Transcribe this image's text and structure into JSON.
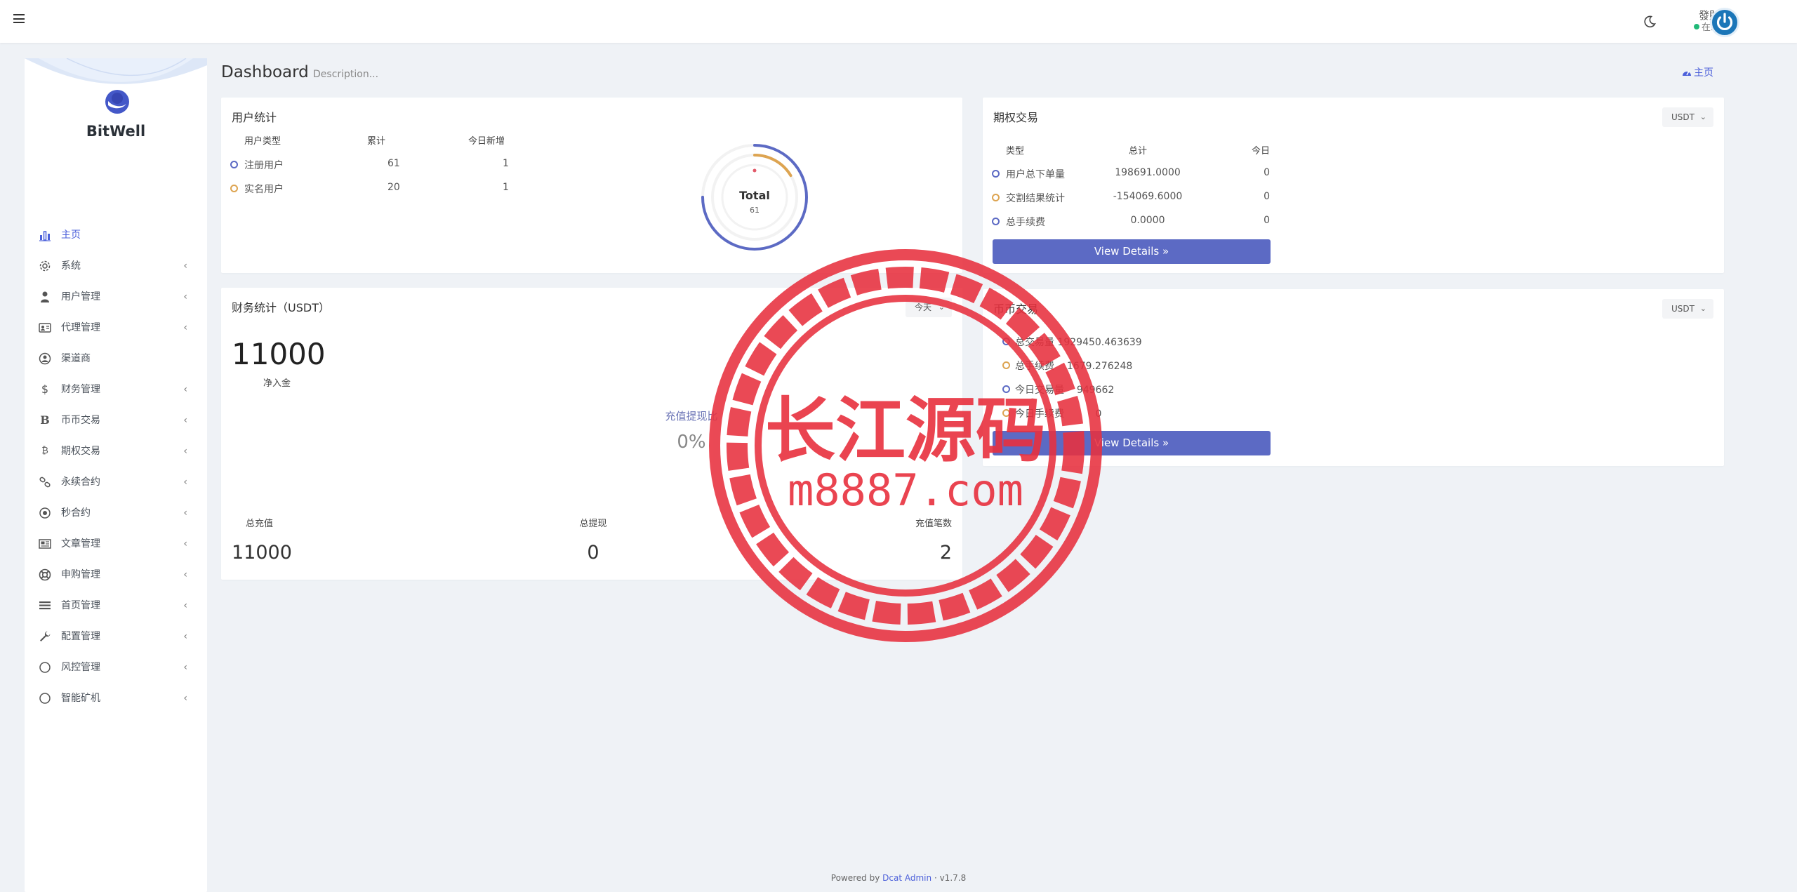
{
  "navbar": {
    "user_name": "發財",
    "user_status": "在线"
  },
  "sidebar": {
    "brand": "BitWell",
    "items": [
      {
        "label": "主页",
        "icon": "bar-chart-icon",
        "active": true,
        "chevron": false
      },
      {
        "label": "系统",
        "icon": "gear-icon",
        "chevron": true
      },
      {
        "label": "用户管理",
        "icon": "user-icon",
        "chevron": true
      },
      {
        "label": "代理管理",
        "icon": "id-card-icon",
        "chevron": true
      },
      {
        "label": "渠道商",
        "icon": "user-circle-icon",
        "chevron": false
      },
      {
        "label": "财务管理",
        "icon": "dollar-icon",
        "chevron": true
      },
      {
        "label": "币币交易",
        "icon": "bitcoin-b-icon",
        "chevron": true
      },
      {
        "label": "期权交易",
        "icon": "bitcoin-icon",
        "chevron": true
      },
      {
        "label": "永续合约",
        "icon": "link-icon",
        "chevron": true
      },
      {
        "label": "秒合约",
        "icon": "record-icon",
        "chevron": true
      },
      {
        "label": "文章管理",
        "icon": "newspaper-icon",
        "chevron": true
      },
      {
        "label": "申购管理",
        "icon": "lifebuoy-icon",
        "chevron": true
      },
      {
        "label": "首页管理",
        "icon": "list-icon",
        "chevron": true
      },
      {
        "label": "配置管理",
        "icon": "wrench-icon",
        "chevron": true
      },
      {
        "label": "风控管理",
        "icon": "circle-icon",
        "chevron": true
      },
      {
        "label": "智能矿机",
        "icon": "circle-icon",
        "chevron": true
      }
    ],
    "chevron": "‹"
  },
  "header": {
    "title": "Dashboard",
    "description": "Description...",
    "crumb": "主页"
  },
  "user_stats": {
    "title": "用户统计",
    "columns": [
      "用户类型",
      "累计",
      "今日新增"
    ],
    "rows": [
      {
        "type": "注册用户",
        "total": "61",
        "today": "1",
        "color": "#5c6ac4"
      },
      {
        "type": "实名用户",
        "total": "20",
        "today": "1",
        "color": "#dda451"
      }
    ],
    "donut_label": "Total",
    "donut_value": "61",
    "colors": {
      "outer": "#5c6ac4",
      "inner": "#dda451",
      "track": "#f0f0f0"
    }
  },
  "finance": {
    "title": "财务统计（USDT）",
    "period": "今天",
    "net_value": "11000",
    "net_label": "净入金",
    "ratio_label": "充值提现比",
    "ratio_value": "0%",
    "stats": [
      {
        "label": "总充值",
        "value": "11000"
      },
      {
        "label": "总提现",
        "value": "0"
      },
      {
        "label": "充值笔数",
        "value": "2"
      }
    ]
  },
  "options": {
    "title": "期权交易",
    "currency": "USDT",
    "columns": [
      "类型",
      "总计",
      "今日"
    ],
    "rows": [
      {
        "type": "用户总下单量",
        "total": "198691.0000",
        "today": "0",
        "color": "#5c6ac4"
      },
      {
        "type": "交割结果统计",
        "total": "-154069.6000",
        "today": "0",
        "color": "#dda451"
      },
      {
        "type": "总手续费",
        "total": "0.0000",
        "today": "0",
        "color": "#5c6ac4"
      }
    ],
    "button": "View Details »"
  },
  "spot": {
    "title": "币币交易",
    "currency": "USDT",
    "rows": [
      {
        "label": "总交易量",
        "value": "1929450.463639",
        "color": "#5c6ac4"
      },
      {
        "label": "总手续费",
        "value": "1679.276248",
        "color": "#dda451"
      },
      {
        "label": "今日交易量",
        "value": "949662",
        "color": "#5c6ac4"
      },
      {
        "label": "今日手续费",
        "value": "0",
        "color": "#dda451"
      }
    ],
    "button": "View Details »"
  },
  "footer": {
    "prefix": "Powered by",
    "link": "Dcat Admin",
    "version": "· v1.7.8"
  },
  "watermark": {
    "line1": "长江源码",
    "line2": "m8887.com",
    "color": "#e8303e"
  }
}
